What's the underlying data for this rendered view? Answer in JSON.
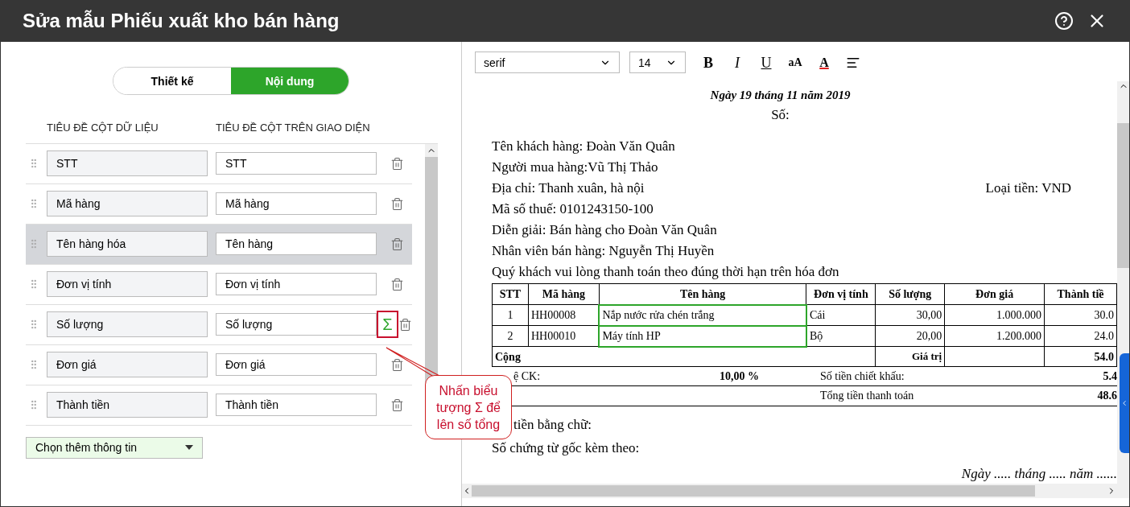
{
  "window": {
    "title": "Sửa mẫu Phiếu xuất kho bán hàng"
  },
  "tabs": [
    {
      "label": "Thiết kế",
      "selected": false
    },
    {
      "label": "Nội dung",
      "selected": true
    }
  ],
  "columns_editor": {
    "headings": [
      "TIÊU ĐỀ CỘT DỮ LIỆU",
      "TIÊU ĐỀ CỘT TRÊN GIAO DIỆN"
    ],
    "rows": [
      {
        "source": "STT",
        "display": "STT",
        "selected": false,
        "sum": false
      },
      {
        "source": "Mã hàng",
        "display": "Mã hàng",
        "selected": false,
        "sum": false
      },
      {
        "source": "Tên hàng hóa",
        "display": "Tên hàng",
        "selected": true,
        "sum": false
      },
      {
        "source": "Đơn vị tính",
        "display": "Đơn vị tính",
        "selected": false,
        "sum": false
      },
      {
        "source": "Số lượng",
        "display": "Số lượng",
        "selected": false,
        "sum": true
      },
      {
        "source": "Đơn giá",
        "display": "Đơn giá",
        "selected": false,
        "sum": false
      },
      {
        "source": "Thành tiền",
        "display": "Thành tiền",
        "selected": false,
        "sum": false
      }
    ],
    "add_dropdown": "Chọn thêm thông tin",
    "sum_glyph": "Σ"
  },
  "callout": {
    "text": "Nhấn biểu tượng Σ để lên số tổng"
  },
  "toolbar": {
    "font": "serif",
    "size": "14",
    "buttons": [
      {
        "kind": "bold",
        "label": "B"
      },
      {
        "kind": "italic",
        "label": "I"
      },
      {
        "kind": "underline",
        "label": "U"
      },
      {
        "kind": "case",
        "label": "aA"
      },
      {
        "kind": "color",
        "label": "A"
      },
      {
        "kind": "align"
      }
    ]
  },
  "document": {
    "date": "Ngày 19 tháng 11 năm 2019",
    "number": "Số:",
    "lines": [
      "Tên khách hàng: Đoàn Văn Quân",
      "Người mua hàng:Vũ Thị Thảo",
      "Địa chỉ: Thanh xuân, hà nội",
      "Mã số thuế: 0101243150-100",
      "Diễn giải: Bán hàng cho Đoàn Văn Quân",
      "Nhân viên bán hàng: Nguyễn Thị Huyền",
      "Quý khách vui lòng thanh toán theo đúng thời hạn trên hóa đơn"
    ],
    "currency": "Loại tiền: VND",
    "table": {
      "columns": [
        {
          "label": "STT",
          "selected": false
        },
        {
          "label": "Mã hàng",
          "selected": false
        },
        {
          "label": "Tên hàng",
          "selected": true
        },
        {
          "label": "Đơn vị tính",
          "selected": false
        },
        {
          "label": "Số lượng",
          "selected": false
        },
        {
          "label": "Đơn giá",
          "selected": false
        },
        {
          "label": "Thành tiề",
          "selected": false
        }
      ],
      "rows": [
        [
          "1",
          "HH00008",
          "Nắp nước rửa chén trắng",
          "Cái",
          "30,00",
          "1.000.000",
          "30.0"
        ],
        [
          "2",
          "HH00010",
          "Máy tính HP",
          "Bộ",
          "20,00",
          "1.200.000",
          "24.0"
        ]
      ],
      "total": {
        "label": "Cộng",
        "value_label": "Giá trị",
        "value": "54.0"
      }
    },
    "discount": {
      "label": "ệ CK:",
      "rate": "10,00 %",
      "amount_label": "Số tiền chiết khấu:",
      "amount": "5.4"
    },
    "grand_total": {
      "label": "Tổng tiền thanh toán",
      "value": "48.6"
    },
    "in_words": "tiền bằng chữ:",
    "attachments": "Số chứng từ gốc kèm theo:",
    "signature_date": "Ngày ..... tháng ..... năm ......"
  }
}
